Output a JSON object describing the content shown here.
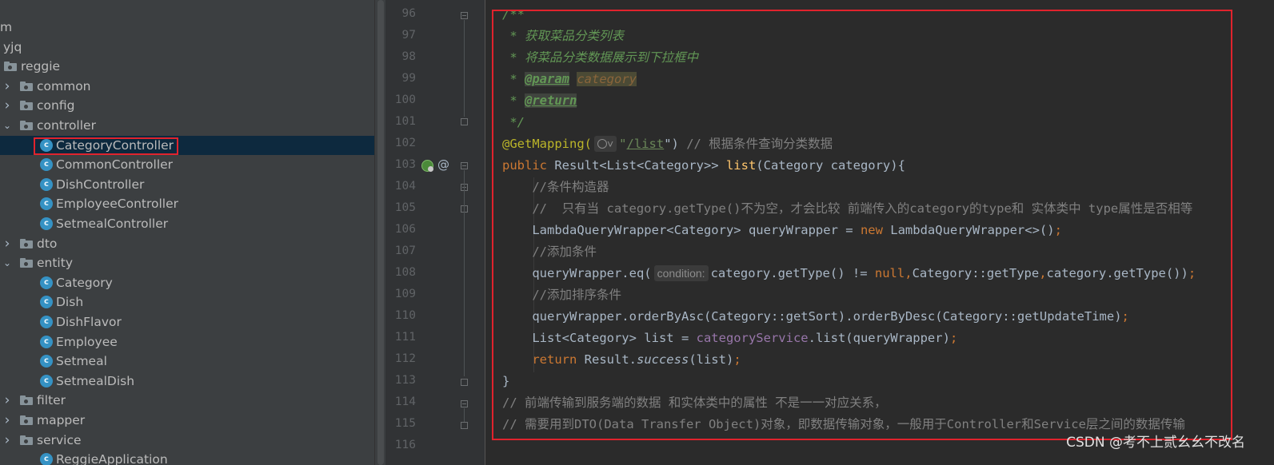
{
  "tree": {
    "rows": [
      {
        "label": "m",
        "depth": 0,
        "kind": "text"
      },
      {
        "label": "yjq",
        "depth": 0,
        "kind": "text"
      },
      {
        "label": "reggie",
        "depth": 0,
        "kind": "folder",
        "arrow": "none"
      },
      {
        "label": "common",
        "depth": 1,
        "kind": "folder",
        "arrow": "collapsed"
      },
      {
        "label": "config",
        "depth": 1,
        "kind": "folder",
        "arrow": "collapsed"
      },
      {
        "label": "controller",
        "depth": 1,
        "kind": "folder",
        "arrow": "expanded"
      },
      {
        "label": "CategoryController",
        "depth": 2,
        "kind": "class",
        "selected": true
      },
      {
        "label": "CommonController",
        "depth": 2,
        "kind": "class"
      },
      {
        "label": "DishController",
        "depth": 2,
        "kind": "class"
      },
      {
        "label": "EmployeeController",
        "depth": 2,
        "kind": "class"
      },
      {
        "label": "SetmealController",
        "depth": 2,
        "kind": "class"
      },
      {
        "label": "dto",
        "depth": 1,
        "kind": "folder",
        "arrow": "collapsed"
      },
      {
        "label": "entity",
        "depth": 1,
        "kind": "folder",
        "arrow": "expanded"
      },
      {
        "label": "Category",
        "depth": 2,
        "kind": "class"
      },
      {
        "label": "Dish",
        "depth": 2,
        "kind": "class"
      },
      {
        "label": "DishFlavor",
        "depth": 2,
        "kind": "class"
      },
      {
        "label": "Employee",
        "depth": 2,
        "kind": "class"
      },
      {
        "label": "Setmeal",
        "depth": 2,
        "kind": "class"
      },
      {
        "label": "SetmealDish",
        "depth": 2,
        "kind": "class"
      },
      {
        "label": "filter",
        "depth": 1,
        "kind": "folder",
        "arrow": "collapsed"
      },
      {
        "label": "mapper",
        "depth": 1,
        "kind": "folder",
        "arrow": "collapsed"
      },
      {
        "label": "service",
        "depth": 1,
        "kind": "folder",
        "arrow": "collapsed"
      },
      {
        "label": "ReggieApplication",
        "depth": 1,
        "kind": "class"
      }
    ]
  },
  "editor": {
    "line_numbers": [
      "96",
      "97",
      "98",
      "99",
      "100",
      "101",
      "102",
      "103",
      "104",
      "105",
      "106",
      "107",
      "108",
      "109",
      "110",
      "111",
      "112",
      "113",
      "114",
      "115",
      "116"
    ],
    "lines": {
      "l96": "/**",
      "l97": " * 获取菜品分类列表",
      "l98": " * 将菜品分类数据展示到下拉框中",
      "l99_star": " * ",
      "l99_tag": "@param",
      "l99_name": "category",
      "l100_star": " * ",
      "l100_tag": "@return",
      "l101": " */",
      "l102_anno": "@GetMapping(",
      "l102_q1": "\"",
      "l102_path": "/list",
      "l102_q2": "\")",
      "l102_cmt": " // 根据条件查询分类数据",
      "l103_kw": "public",
      "l103_type": " Result<List<Category>> ",
      "l103_method": "list",
      "l103_rest": "(Category category){",
      "l104": "    //条件构造器",
      "l105": "    //  只有当 category.getType()不为空，才会比较 前端传入的category的type和 实体类中 type属性是否相等",
      "l106_a": "    LambdaQueryWrapper<Category> queryWrapper = ",
      "l106_kw": "new",
      "l106_b": " LambdaQueryWrapper<>()",
      "l106_semi": ";",
      "l107": "    //添加条件",
      "l108_a": "    queryWrapper.eq(",
      "l108_hint": "condition:",
      "l108_b": "category.getType() != ",
      "l108_null": "null",
      "l108_c1": ",",
      "l108_d": "Category::getType",
      "l108_c2": ",",
      "l108_e": "category.getType())",
      "l108_semi": ";",
      "l109": "    //添加排序条件",
      "l110_a": "    queryWrapper.orderByAsc(Category::getSort).orderByDesc(Category::getUpdateTime)",
      "l110_semi": ";",
      "l111_a": "    List<Category> list = ",
      "l111_field": "categoryService",
      "l111_b": ".list(queryWrapper)",
      "l111_semi": ";",
      "l112_indent": "    ",
      "l112_kw": "return",
      "l112_a": " Result.",
      "l112_static": "success",
      "l112_b": "(list)",
      "l112_semi": ";",
      "l113": "}",
      "l114": "// 前端传输到服务端的数据 和实体类中的属性 不是一一对应关系，",
      "l115": "// 需要用到DTO(Data Transfer Object)对象，即数据传输对象，一般用于Controller和Service层之间的数据传输"
    }
  },
  "watermark": "CSDN @考不上贰幺幺不改名",
  "colors": {
    "highlight_box": "#e0232d",
    "selected_row": "#0d293e",
    "class_icon": "#3592c4"
  },
  "icons": {
    "gutter_run": "spring-web-endpoint-icon",
    "gutter_at": "annotation-at-icon"
  }
}
